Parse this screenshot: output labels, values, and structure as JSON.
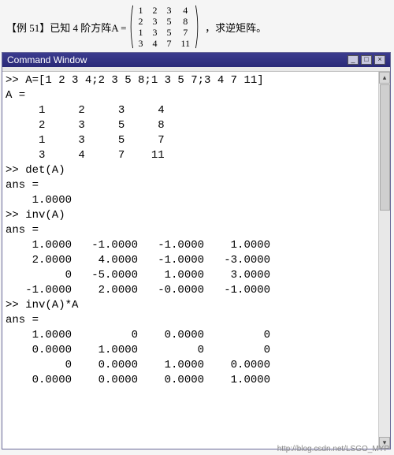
{
  "problem": {
    "prefix": "【例 51】已知 4 阶方阵A = ",
    "matrix": [
      [
        "1",
        "2",
        "3",
        "4"
      ],
      [
        "2",
        "3",
        "5",
        "8"
      ],
      [
        "1",
        "3",
        "5",
        "7"
      ],
      [
        "3",
        "4",
        "7",
        "11"
      ]
    ],
    "suffix": "，求逆矩阵。"
  },
  "window": {
    "title": "Command Window",
    "min": "_",
    "max": "□",
    "close": "×",
    "scroll_up": "▴",
    "scroll_down": "▾"
  },
  "console": {
    "lines": [
      ">> A=[1 2 3 4;2 3 5 8;1 3 5 7;3 4 7 11]",
      "A =",
      "     1     2     3     4",
      "     2     3     5     8",
      "     1     3     5     7",
      "     3     4     7    11",
      ">> det(A)",
      "ans =",
      "    1.0000",
      ">> inv(A)",
      "ans =",
      "    1.0000   -1.0000   -1.0000    1.0000",
      "    2.0000    4.0000   -1.0000   -3.0000",
      "         0   -5.0000    1.0000    3.0000",
      "   -1.0000    2.0000   -0.0000   -1.0000",
      ">> inv(A)*A",
      "ans =",
      "    1.0000         0    0.0000         0",
      "    0.0000    1.0000         0         0",
      "         0    0.0000    1.0000    0.0000",
      "    0.0000    0.0000    0.0000    1.0000"
    ]
  },
  "watermark": "http://blog.csdn.net/LSGO_MYP"
}
